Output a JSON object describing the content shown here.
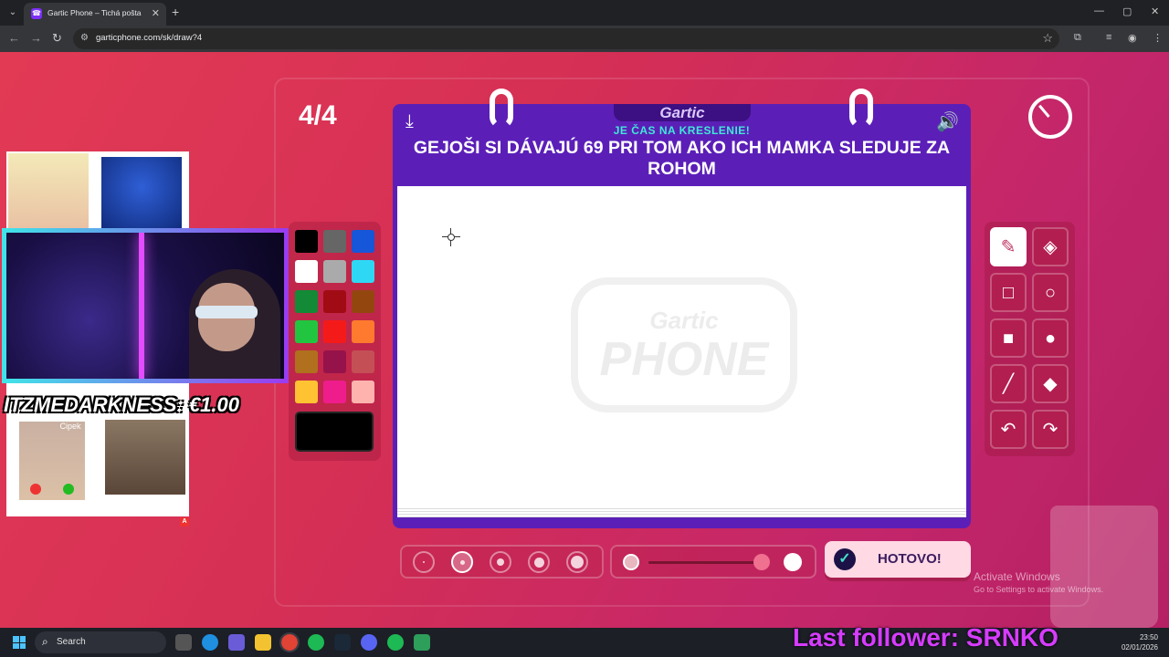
{
  "browser": {
    "tab_title": "Gartic Phone – Tichá pošta",
    "url": "garticphone.com/sk/draw?4",
    "new_tab": "+",
    "controls": {
      "minimize": "—",
      "maximize": "▢",
      "close": "✕"
    }
  },
  "game": {
    "round": "4/4",
    "logo": "Gartic",
    "subtitle": "JE ČAS NA KRESLENIE!",
    "prompt": "GEJOŠI SI DÁVAJÚ 69 PRI TOM AKO ICH MAMKA SLEDUJE ZA ROHOM",
    "watermark_small": "Gartic",
    "watermark_big": "PHONE",
    "done_label": "HOTOVO!",
    "palette": [
      "#000000",
      "#666666",
      "#1656d8",
      "#ffffff",
      "#aaaaaa",
      "#2ed8f5",
      "#138a36",
      "#a10c14",
      "#93470f",
      "#22c53f",
      "#f51a1a",
      "#ff7a2e",
      "#b0701d",
      "#96124a",
      "#c44f55",
      "#ffc232",
      "#ee1d8b",
      "#ffb3ae"
    ],
    "selected_color": "#000000",
    "tools": [
      {
        "name": "pencil-tool",
        "glyph": "✎",
        "active": true
      },
      {
        "name": "eraser-tool",
        "glyph": "◈",
        "active": false
      },
      {
        "name": "rectangle-outline-tool",
        "glyph": "□",
        "active": false
      },
      {
        "name": "circle-outline-tool",
        "glyph": "○",
        "active": false
      },
      {
        "name": "rectangle-fill-tool",
        "glyph": "■",
        "active": false
      },
      {
        "name": "circle-fill-tool",
        "glyph": "●",
        "active": false
      },
      {
        "name": "line-tool",
        "glyph": "╱",
        "active": false
      },
      {
        "name": "fill-bucket-tool",
        "glyph": "◆",
        "active": false
      },
      {
        "name": "undo-tool",
        "glyph": "↶",
        "active": false
      },
      {
        "name": "redo-tool",
        "glyph": "↷",
        "active": false
      }
    ],
    "brush_sizes": 5,
    "selected_brush_size": 2,
    "opacity_fraction": 0.95
  },
  "overlay": {
    "donation": "ITZMEDARKNESS: €1.00",
    "cipek": "Cipek",
    "badge": "A",
    "last_follower": "Last follower: SRNKO"
  },
  "windows": {
    "activate_title": "Activate Windows",
    "activate_sub": "Go to Settings to activate Windows.",
    "search_label": "Search",
    "time": "23:50",
    "date": "02/01/2026"
  },
  "colors": {
    "accent_purple": "#5b1fb8",
    "page_red": "#d52f55",
    "follower_text": "#d63cff"
  }
}
